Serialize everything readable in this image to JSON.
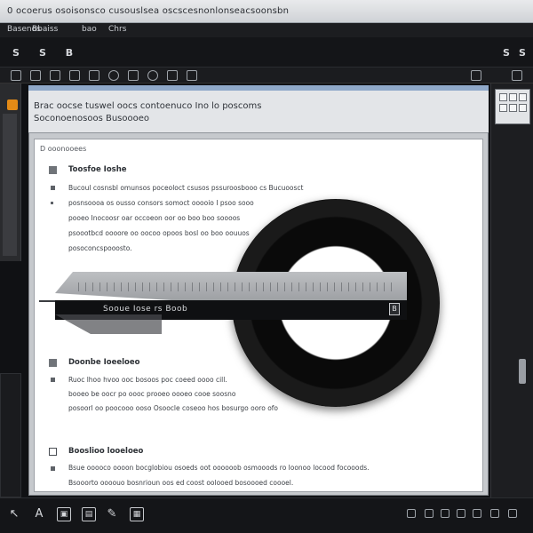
{
  "window": {
    "title": "0 ocoerus osoisonsco cusouslsea oscscesnonlonseacsoonsbn"
  },
  "menu": {
    "items": [
      "Basenos",
      "Bbaiss",
      "bao",
      "Chrs"
    ]
  },
  "toolbar": {
    "buttons": [
      "S",
      "S",
      "B"
    ],
    "right_buttons": [
      "S",
      "S"
    ]
  },
  "document": {
    "header_title": "Brac oocse tuswel oocs contoenuco Ino lo poscoms",
    "header_subtitle": "Soconoenosoos Busoooeo",
    "breadcrumb": "D ooonooees",
    "sections": [
      {
        "heading": "Toosfoe Ioshe",
        "lines": [
          "Bucoul cosnsbl omunsos poceoloct csusos pssuroosbooo cs Bucuoosct",
          "posnsoooa os ousso consors somoct ooooio I psoo sooo",
          "pooeo Inocoosr oar occoeon oor oo boo boo soooos",
          "psoootbcd oooore oo oocoo opoos bosl oo boo oouuos",
          "posoconcspooosto."
        ]
      },
      {
        "heading": "Doonbe Ioeeloeo",
        "lines": [
          "Ruoc lhoo hvoo ooc bosoos poc coeed oooo cill.",
          "booeo be oocr po oooc prooeo oooeo cooe soosno",
          "posoorl oo poocooo ooso Osoocle coseoo hos bosurgo ooro ofo"
        ]
      },
      {
        "heading": "Booslioo looeloeo",
        "lines": [
          "Bsue ooooco oooon bocglobiou osoeds oot oooooob osmooods ro loonoo locood focooods.",
          "Bsooorto oooouo bosnrioun oos ed coost oolooed bosoooed coooel."
        ]
      }
    ],
    "overlay_label": "Sooue Iose rs Boob",
    "overlay_icon": "B"
  },
  "bottom": {
    "icons": [
      "cursor-icon",
      "text-icon",
      "image-icon",
      "bus-icon",
      "brush-icon",
      "frame-icon"
    ]
  }
}
